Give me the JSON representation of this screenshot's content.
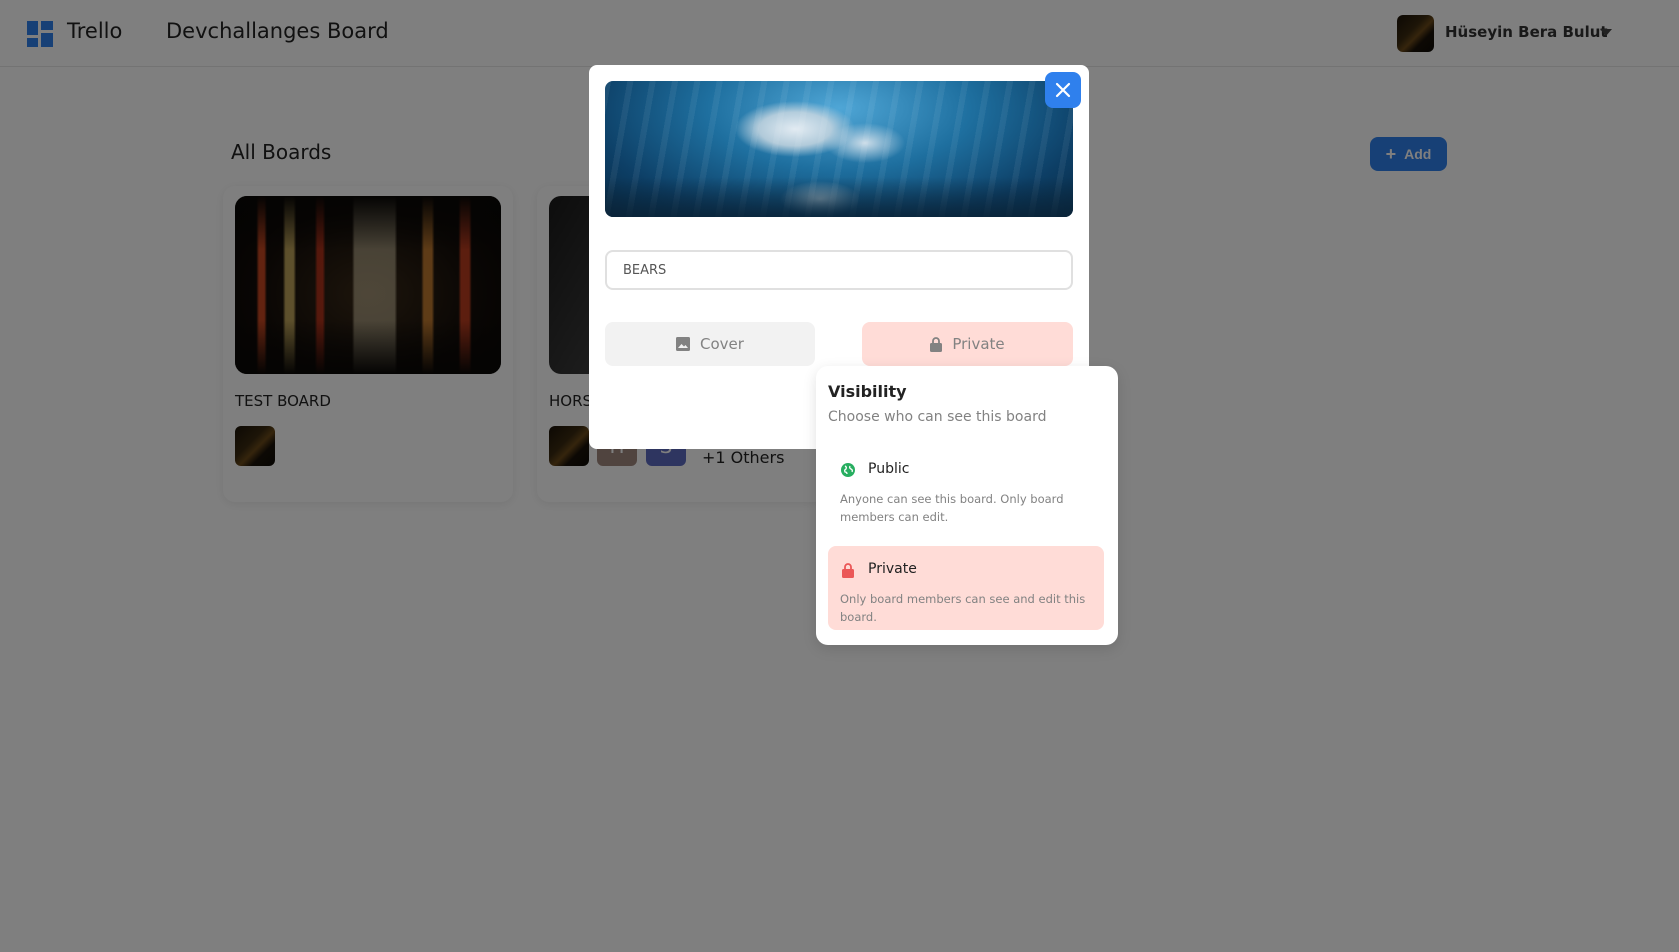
{
  "header": {
    "brand": "Trello",
    "board_title": "Devchallanges Board",
    "user_name": "Hüseyin Bera Bulut"
  },
  "main": {
    "heading": "All Boards",
    "add_label": "Add",
    "boards": [
      {
        "title": "TEST BOARD"
      },
      {
        "title": "HORS",
        "member_letters": [
          "H",
          "S"
        ],
        "others_label": "+1 Others"
      }
    ]
  },
  "modal": {
    "title_input_value": "BEARS",
    "cover_label": "Cover",
    "visibility_label": "Private"
  },
  "visibility_menu": {
    "title": "Visibility",
    "subtitle": "Choose who can see this board",
    "options": [
      {
        "label": "Public",
        "description": "Anyone can see this board. Only board members can edit."
      },
      {
        "label": "Private",
        "description": "Only board members can see and edit this board."
      }
    ]
  },
  "colors": {
    "accent": "#2f80ed",
    "private_bg": "#ffdcd7",
    "public_icon": "#27ae60",
    "private_icon": "#eb5757",
    "muted_text": "#828282"
  },
  "icons": {
    "logo": "trello-grid-icon",
    "add": "plus-icon",
    "close": "close-icon",
    "cover": "image-icon",
    "private": "lock-icon",
    "public": "globe-icon",
    "user_menu": "caret-down-icon"
  }
}
